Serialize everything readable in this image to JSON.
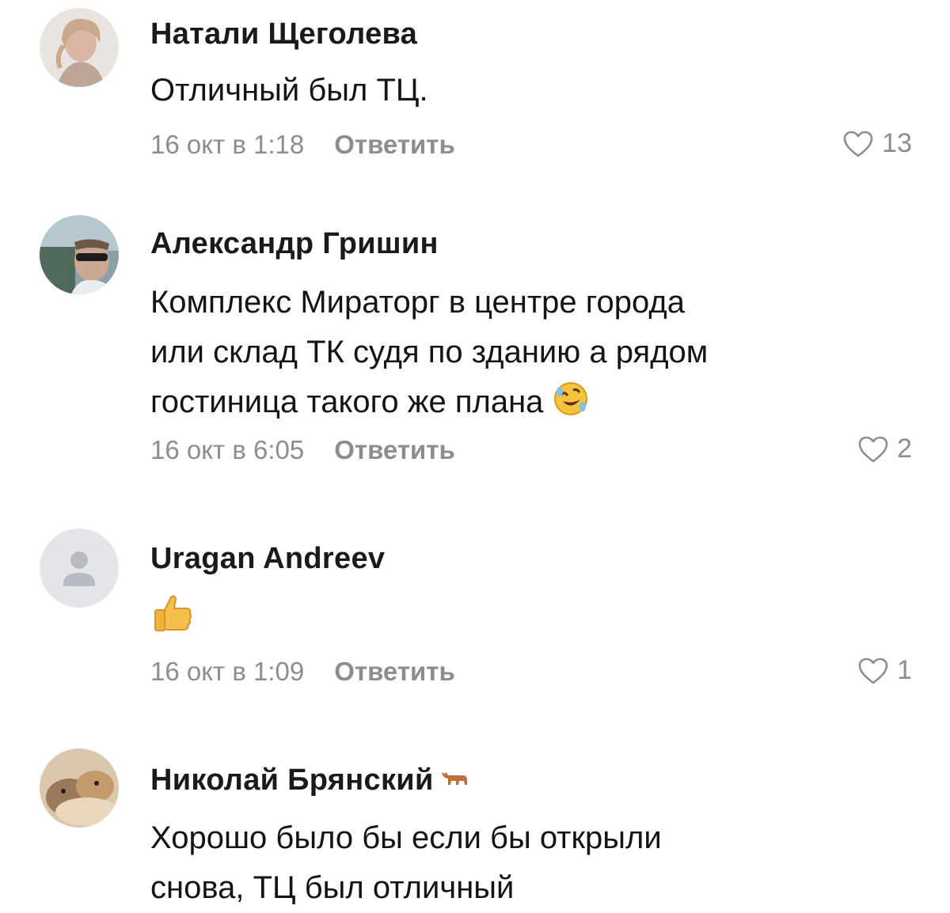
{
  "comments": [
    {
      "author": "Натали Щеголева",
      "lines": [
        "Отличный был ТЦ."
      ],
      "date": "16 окт в 1:18",
      "reply_label": "Ответить",
      "likes": "13",
      "avatar": "photo-woman-avatar"
    },
    {
      "author": "Александр Гришин",
      "lines": [
        "Комплекс Мираторг в центре города",
        "или склад ТК судя по зданию а рядом",
        "гостиница такого же плана"
      ],
      "emoji": "rolling-on-floor-laughing-emoji",
      "date": "16 окт в 6:05",
      "reply_label": "Ответить",
      "likes": "2",
      "avatar": "photo-man-sunglasses-avatar"
    },
    {
      "author": "Uragan Andreev",
      "lines": [],
      "emoji": "thumbs-up-emoji",
      "date": "16 окт в 1:09",
      "reply_label": "Ответить",
      "likes": "1",
      "avatar": "default-user-avatar"
    },
    {
      "author": "Николай Брянский",
      "author_badge": "bull-icon",
      "lines": [
        "Хорошо было бы если бы открыли",
        "снова, ТЦ был отличный"
      ],
      "avatar": "photo-dogs-avatar"
    }
  ],
  "colors": {
    "text": "#141414",
    "meta": "#8a8d92",
    "default_avatar_bg": "#e3e5e8"
  }
}
